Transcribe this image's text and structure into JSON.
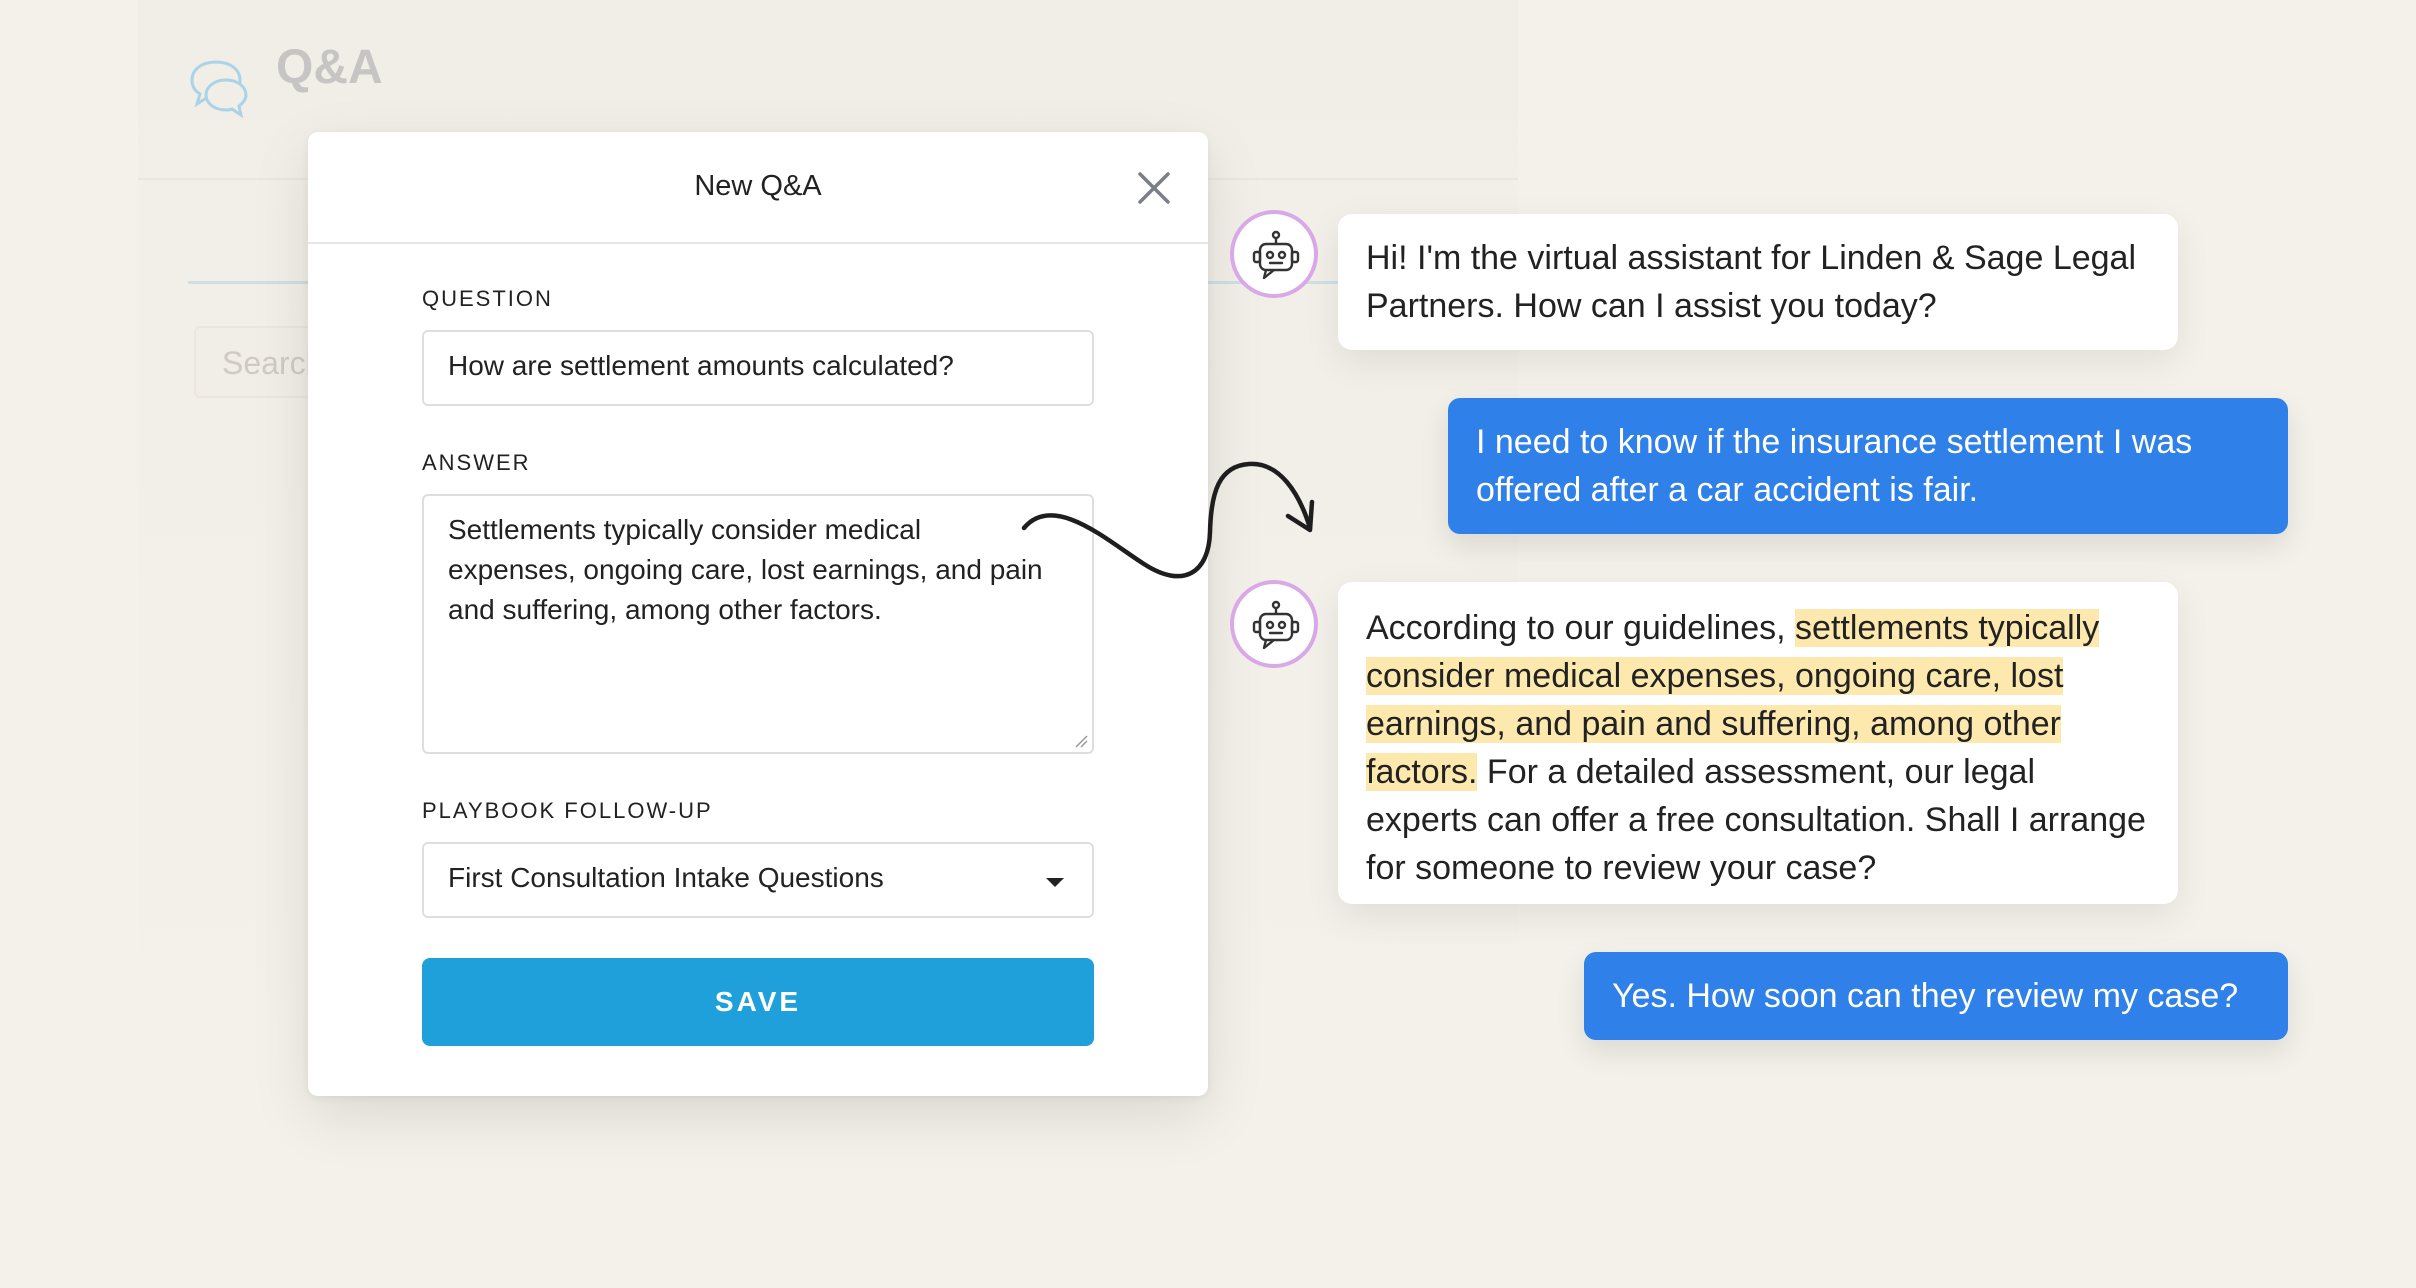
{
  "background": {
    "title": "Q&A",
    "search_placeholder": "Search",
    "icon": "chat-bubbles-icon"
  },
  "modal": {
    "title": "New Q&A",
    "close_icon": "close-icon",
    "question_label": "QUESTION",
    "question_value": "How are settlement amounts calculated?",
    "answer_label": "ANSWER",
    "answer_value": "Settlements typically consider medical expenses, ongoing care, lost earnings, and pain and suffering, among other factors.",
    "followup_label": "PLAYBOOK FOLLOW-UP",
    "followup_value": "First Consultation Intake Questions",
    "save_label": "SAVE"
  },
  "chat": {
    "bot_avatar_icon": "robot-icon",
    "messages": [
      {
        "role": "bot",
        "text": "Hi! I'm the virtual assistant for Linden & Sage Legal Partners. How can I assist you today?"
      },
      {
        "role": "user",
        "text": "I need to know if the insurance settlement I was offered after a car accident is fair."
      },
      {
        "role": "bot",
        "pre": "According to our guidelines, ",
        "highlight": "settlements typically consider medical expenses, ongoing care, lost earnings, and pain and suffering, among other factors.",
        "post": " For a detailed assessment, our legal experts can offer a free consultation. Shall I arrange for someone to review your case?"
      },
      {
        "role": "user",
        "text": "Yes. How soon can they review my case?"
      }
    ]
  },
  "colors": {
    "page_bg": "#f4f1ea",
    "save_button": "#1fa0da",
    "user_bubble": "#2f80e9",
    "highlight": "#fde9ae",
    "avatar_ring": "#d9a8e6"
  }
}
